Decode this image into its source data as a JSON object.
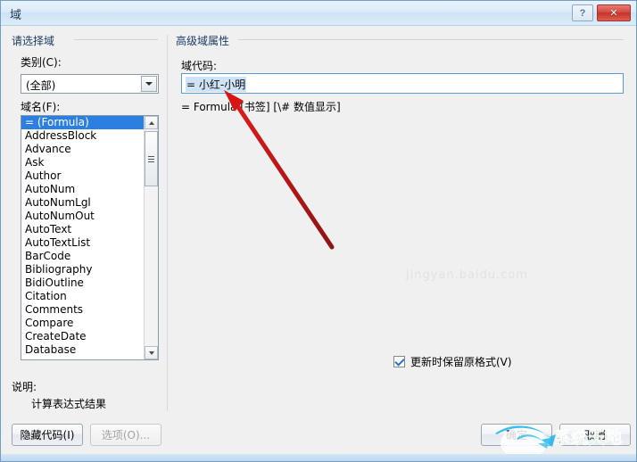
{
  "window": {
    "title": "域",
    "help_label": "?",
    "close_label": "✕"
  },
  "left_panel": {
    "group_title": "请选择域",
    "category_label": "类别(C):",
    "category_value": "(全部)",
    "fieldname_label": "域名(F):",
    "field_list": [
      "= (Formula)",
      "AddressBlock",
      "Advance",
      "Ask",
      "Author",
      "AutoNum",
      "AutoNumLgl",
      "AutoNumOut",
      "AutoText",
      "AutoTextList",
      "BarCode",
      "Bibliography",
      "BidiOutline",
      "Citation",
      "Comments",
      "Compare",
      "CreateDate",
      "Database"
    ],
    "selected_index": 0,
    "description_label": "说明:",
    "description_text": "计算表达式结果",
    "hide_code_button": "隐藏代码(I)",
    "options_button": "选项(O)..."
  },
  "right_panel": {
    "group_title": "高级域属性",
    "code_label": "域代码:",
    "code_value": "= 小红-小明",
    "code_syntax": "= Formula [书签] [\\# 数值显示]",
    "preserve_format_label": "更新时保留原格式(V)",
    "preserve_format_checked": true
  },
  "footer": {
    "ok_button": "确定",
    "cancel_button": "取消"
  },
  "watermark": {
    "text": "系统天地",
    "faint_text": "jingyan.baidu.com"
  },
  "colors": {
    "accent": "#2a7fe0",
    "selection": "#cfe3f7",
    "close_red": "#c33427",
    "annotation_red": "#cc1a1a",
    "watermark_cyan": "#00a0e0",
    "watermark_green": "#4caf21"
  }
}
